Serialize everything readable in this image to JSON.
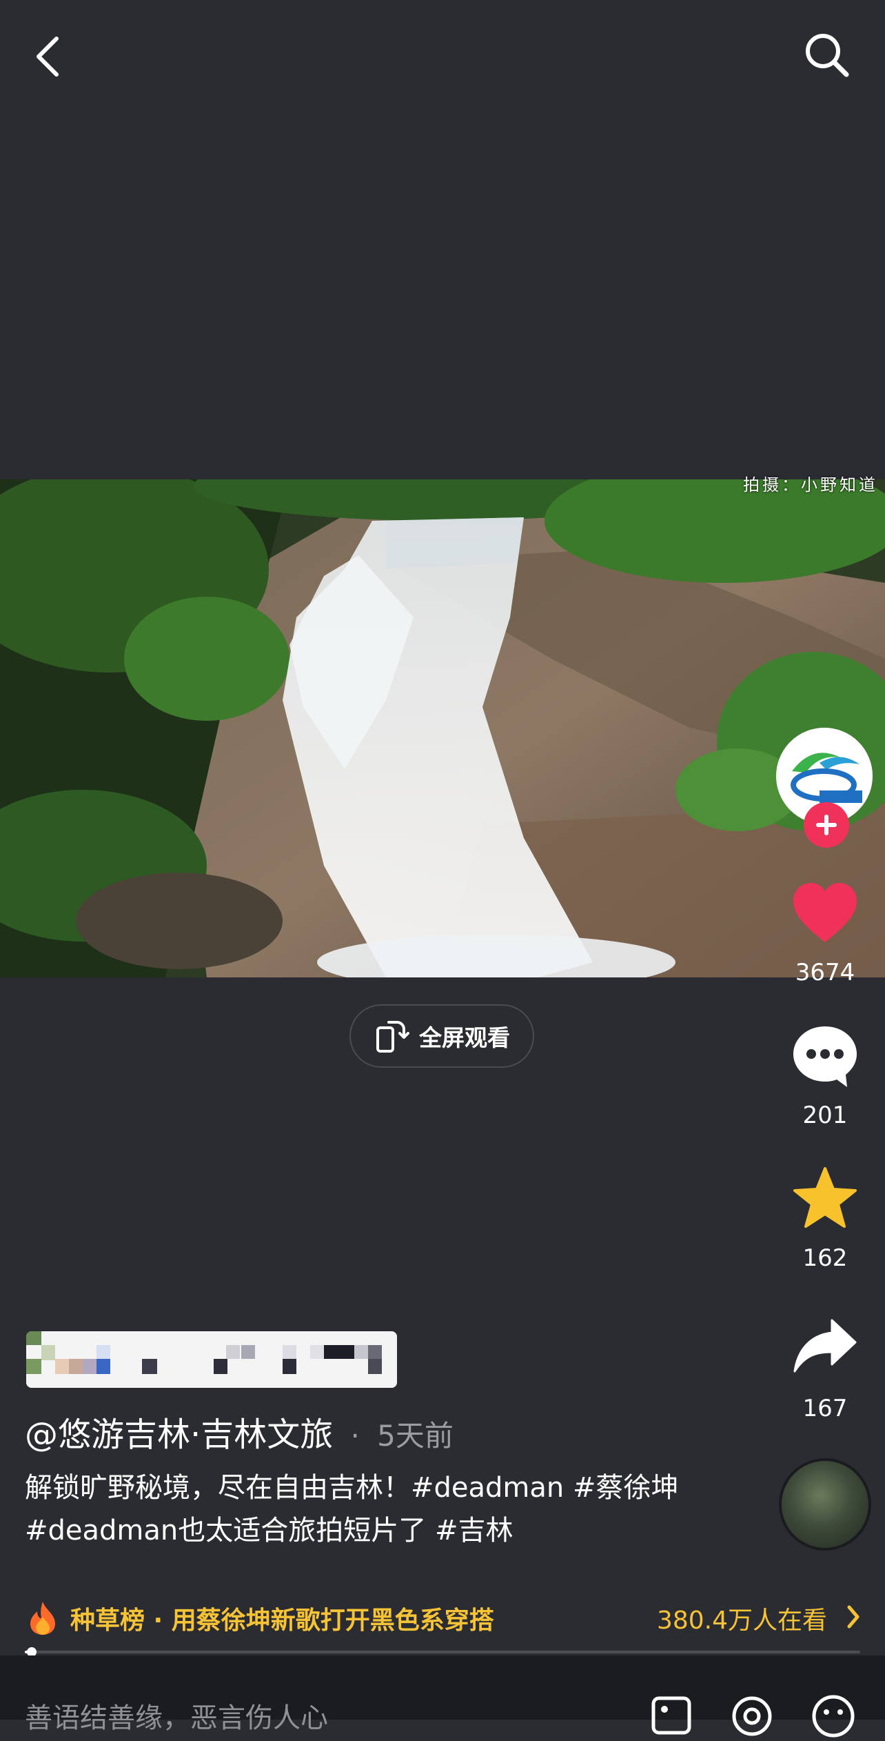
{
  "header": {
    "back_icon": "chevron-left-icon",
    "search_icon": "search-icon"
  },
  "video": {
    "credit_text": "拍摄：小野知道"
  },
  "fullscreen": {
    "label": "全屏观看",
    "icon": "rotate-phone-icon"
  },
  "actions": {
    "like_count": "3674",
    "comment_count": "201",
    "favorite_count": "162",
    "share_count": "167",
    "colors": {
      "like": "#f0315a",
      "favorite": "#f8c22d",
      "follow": "#f0315a"
    }
  },
  "post": {
    "author": "@悠游吉林·吉林文旅",
    "separator": "·",
    "time_ago": "5天前",
    "caption": "解锁旷野秘境，尽在自由吉林！#deadman #蔡徐坤 #deadman也太适合旅拍短片了 #吉林"
  },
  "trending": {
    "label": "种草榜 · 用蔡徐坤新歌打开黑色系穿搭",
    "viewers": "380.4万人在看",
    "color": "#f6c336"
  },
  "playback": {
    "progress": 0.008
  },
  "comment_bar": {
    "placeholder": "善语结善缘，恶言伤人心"
  }
}
